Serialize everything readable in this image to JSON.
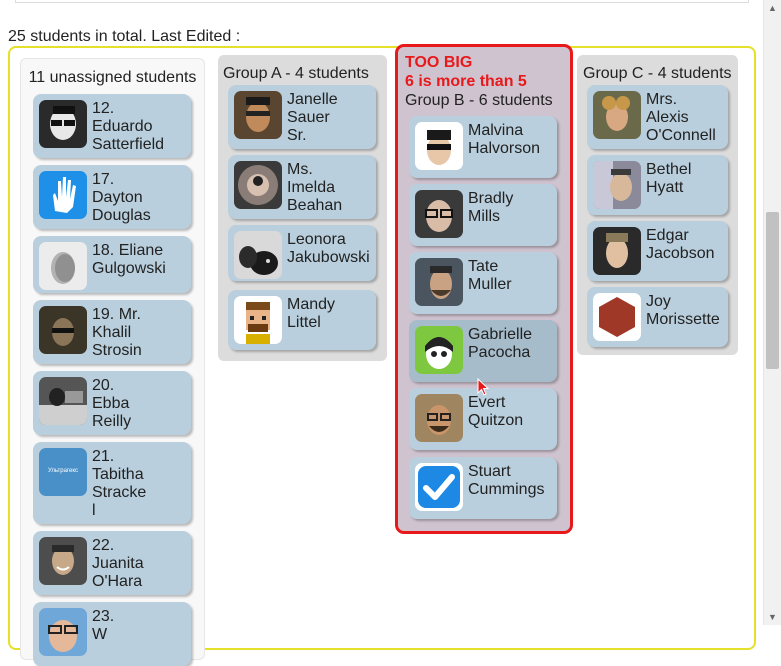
{
  "summary": "25 students in total. Last Edited :",
  "unassigned": {
    "title": "11 unassigned students",
    "students": [
      {
        "label": "12.\nEduardo\nSatterfield",
        "icon": "man-glasses-avatar"
      },
      {
        "label": "17.\nDayton\nDouglas",
        "icon": "hand-avatar"
      },
      {
        "label": "18. Eliane\nGulgowski",
        "icon": "blurred-face-avatar"
      },
      {
        "label": "19. Mr.\nKhalil\nStrosin",
        "icon": "dark-sunglasses-avatar"
      },
      {
        "label": "20.\nEbba\nReilly",
        "icon": "bw-photo-avatar"
      },
      {
        "label": "21.\nTabitha\nStracke\nl",
        "icon": "blue-logo-avatar",
        "avatar_text": "Ультрагекс"
      },
      {
        "label": "22.\nJuanita\nO'Hara",
        "icon": "man-smiling-avatar"
      },
      {
        "label": "23.\nW",
        "icon": "glasses-avatar"
      }
    ]
  },
  "group_a": {
    "title": "Group A - 4 students",
    "students": [
      {
        "label": "Janelle\nSauer\nSr.",
        "icon": "man-portrait-avatar"
      },
      {
        "label": "Ms.\nImelda\nBeahan",
        "icon": "fisheye-avatar"
      },
      {
        "label": "Leonora\nJakubowski",
        "icon": "dog-avatar"
      },
      {
        "label": "Mandy\nLittel",
        "icon": "pixel-art-avatar"
      }
    ]
  },
  "group_b": {
    "warning_title": "TOO BIG",
    "warning_detail": "6 is more than 5",
    "title": "Group B - 6 students",
    "students": [
      {
        "label": "Malvina\nHalvorson",
        "icon": "sunglasses-avatar"
      },
      {
        "label": "Bradly\nMills",
        "icon": "woman-glasses-avatar"
      },
      {
        "label": "Tate\nMuller",
        "icon": "man-beard-avatar"
      },
      {
        "label": "Gabrielle\nPacocha",
        "icon": "cartoon-avatar"
      },
      {
        "label": "Evert\nQuitzon",
        "icon": "man-glasses-outdoor-avatar"
      },
      {
        "label": "Stuart\nCummings",
        "icon": "checkmark-avatar"
      }
    ]
  },
  "group_c": {
    "title": "Group C - 4 students",
    "students": [
      {
        "label": "Mrs.\nAlexis\nO'Connell",
        "icon": "curly-hair-avatar"
      },
      {
        "label": "Bethel\nHyatt",
        "icon": "man-window-avatar"
      },
      {
        "label": "Edgar\nJacobson",
        "icon": "man-blond-avatar"
      },
      {
        "label": "Joy\nMorissette",
        "icon": "hexagon-avatar"
      }
    ]
  },
  "colors": {
    "board_border": "#e5e02a",
    "card": "#b9cfdd",
    "warning": "#e8191b",
    "group_b_bg": "#cfc3cf"
  }
}
